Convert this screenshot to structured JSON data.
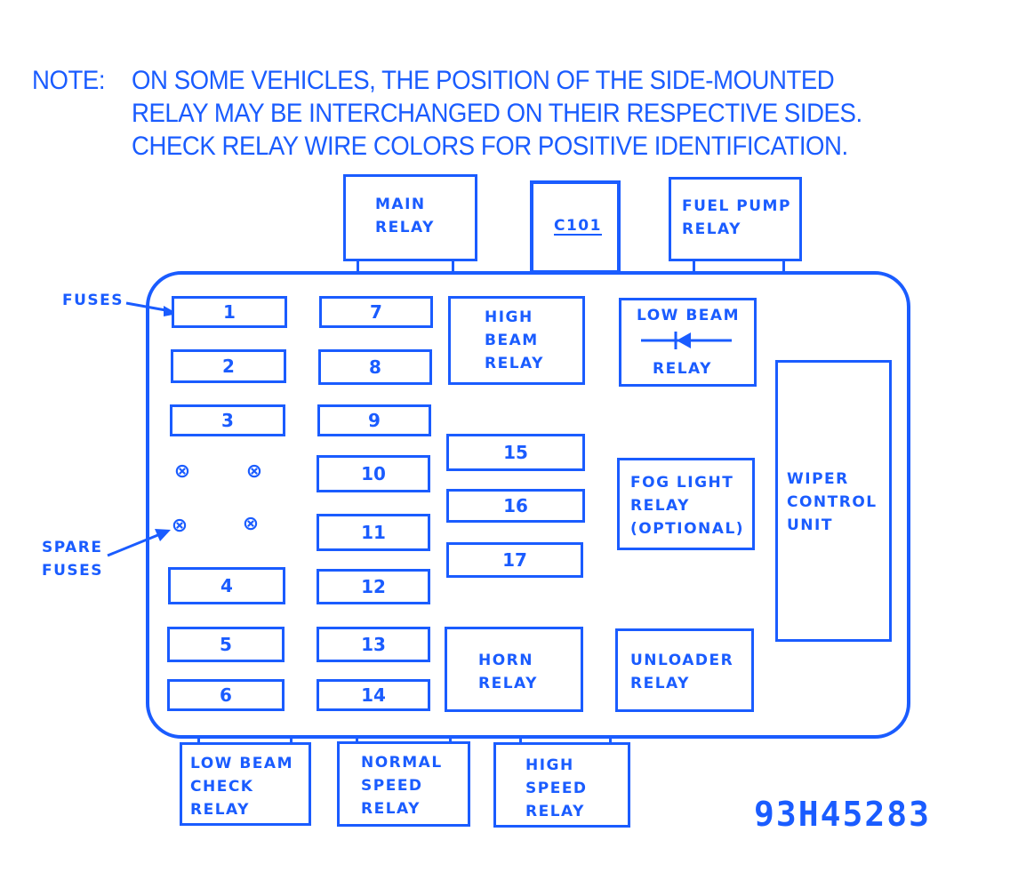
{
  "note": {
    "prefix": "NOTE:",
    "lines": [
      "ON SOME VEHICLES, THE POSITION OF THE SIDE-MOUNTED",
      "RELAY MAY BE INTERCHANGED ON THEIR RESPECTIVE SIDES.",
      "CHECK RELAY WIRE COLORS FOR POSITIVE IDENTIFICATION."
    ]
  },
  "top_components": {
    "main_relay": "MAIN\nRELAY",
    "connector": "C101",
    "fuel_pump_relay": "FUEL PUMP\nRELAY"
  },
  "callouts": {
    "fuses": "FUSES",
    "spare_fuses": "SPARE\nFUSES"
  },
  "fuses": [
    "1",
    "2",
    "3",
    "4",
    "5",
    "6",
    "7",
    "8",
    "9",
    "10",
    "11",
    "12",
    "13",
    "14",
    "15",
    "16",
    "17"
  ],
  "relays": {
    "high_beam": "HIGH\nBEAM\nRELAY",
    "low_beam_top": "LOW BEAM",
    "low_beam_bottom": "RELAY",
    "fog_light": "FOG LIGHT\nRELAY\n(OPTIONAL)",
    "wiper": "WIPER\nCONTROL\nUNIT",
    "horn": "HORN\nRELAY",
    "unloader": "UNLOADER\nRELAY"
  },
  "bottom_components": {
    "low_beam_check": "LOW BEAM\nCHECK\nRELAY",
    "normal_speed": "NORMAL\nSPEED\nRELAY",
    "high_speed": "HIGH\nSPEED\nRELAY"
  },
  "icons": {
    "spare_fuse": "⊗",
    "diode": "diode-symbol"
  },
  "diagram_code": "93H45283",
  "colors": {
    "ink": "#1a5cff",
    "background": "#ffffff"
  }
}
